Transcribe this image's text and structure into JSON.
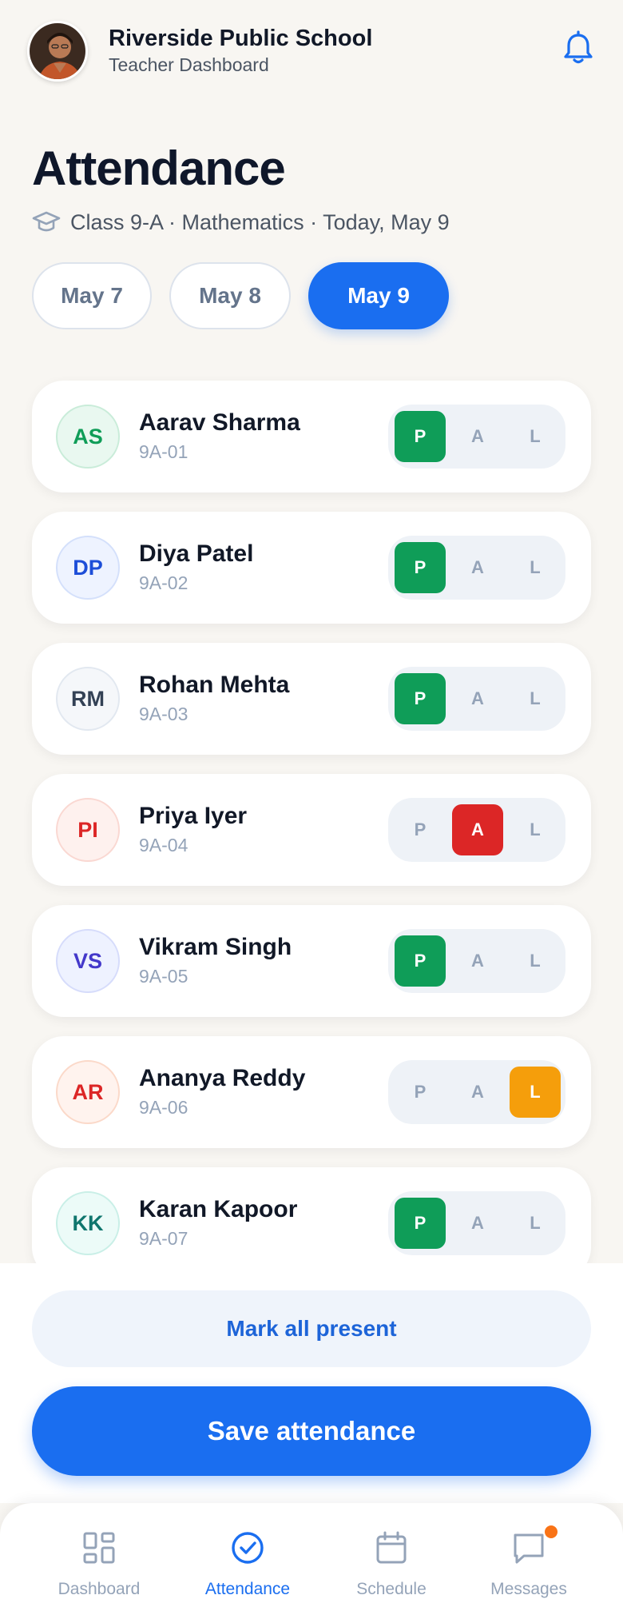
{
  "header": {
    "school_name": "Riverside Public School",
    "subtitle": "Teacher Dashboard",
    "avatar": "teacher-avatar-photo",
    "notification_icon": "bell-icon"
  },
  "page": {
    "title": "Attendance",
    "class_info": "Class 9-A · Mathematics · Today, May 9",
    "class_icon": "graduation-cap-icon"
  },
  "date_tabs": [
    {
      "label": "May 7",
      "selected": false
    },
    {
      "label": "May 8",
      "selected": false
    },
    {
      "label": "May 9",
      "selected": true
    }
  ],
  "status_labels": {
    "present": "P",
    "absent": "A",
    "late": "L"
  },
  "students": [
    {
      "initials": "AS",
      "name": "Aarav Sharma",
      "id": "9A-01",
      "status": "P",
      "avatar_text": "#0f9d58",
      "avatar_bg": "#e9f8f0",
      "avatar_border": "#c9ecd9"
    },
    {
      "initials": "DP",
      "name": "Diya Patel",
      "id": "9A-02",
      "status": "P",
      "avatar_text": "#1d4ed8",
      "avatar_bg": "#eef3ff",
      "avatar_border": "#d4e0fb"
    },
    {
      "initials": "RM",
      "name": "Rohan Mehta",
      "id": "9A-03",
      "status": "P",
      "avatar_text": "#334155",
      "avatar_bg": "#f5f7fa",
      "avatar_border": "#e2e8f0"
    },
    {
      "initials": "PI",
      "name": "Priya Iyer",
      "id": "9A-04",
      "status": "A",
      "avatar_text": "#dc2626",
      "avatar_bg": "#fef1ee",
      "avatar_border": "#fad8d2"
    },
    {
      "initials": "VS",
      "name": "Vikram Singh",
      "id": "9A-05",
      "status": "P",
      "avatar_text": "#4338ca",
      "avatar_bg": "#eef2ff",
      "avatar_border": "#d6dcfb"
    },
    {
      "initials": "AR",
      "name": "Ananya Reddy",
      "id": "9A-06",
      "status": "L",
      "avatar_text": "#dc2626",
      "avatar_bg": "#fff3ee",
      "avatar_border": "#fbd9c9"
    },
    {
      "initials": "KK",
      "name": "Karan Kapoor",
      "id": "9A-07",
      "status": "P",
      "avatar_text": "#0f766e",
      "avatar_bg": "#ecfbf8",
      "avatar_border": "#c9efe7"
    }
  ],
  "actions": {
    "mark_all": "Mark all present",
    "save": "Save attendance"
  },
  "nav": [
    {
      "label": "Dashboard",
      "icon": "grid-icon",
      "active": false
    },
    {
      "label": "Attendance",
      "icon": "check-circle-icon",
      "active": true
    },
    {
      "label": "Schedule",
      "icon": "calendar-icon",
      "active": false
    },
    {
      "label": "Messages",
      "icon": "chat-icon",
      "active": false,
      "has_notification": true
    }
  ],
  "colors": {
    "primary": "#1a6ef0",
    "present": "#0f9d58",
    "absent": "#dc2626",
    "late": "#f59e0b",
    "background": "#f8f6f2"
  }
}
